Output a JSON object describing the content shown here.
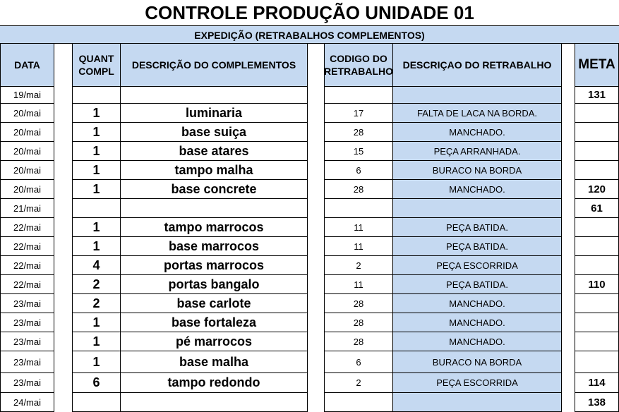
{
  "title": "CONTROLE PRODUÇÃO UNIDADE 01",
  "subtitle": "EXPEDIÇÃO (RETRABALHOS COMPLEMENTOS)",
  "headers": {
    "date": "DATA",
    "qty": "QUANT COMPL",
    "desc": "DESCRIÇÃO DO COMPLEMENTOS",
    "code": "CODIGO DO RETRABALHO",
    "retr": "DESCRIÇAO DO RETRABALHO",
    "meta": "META"
  },
  "colors": {
    "header_blue": "#c5d9f1"
  },
  "rows": [
    {
      "date": "19/mai",
      "qty": "",
      "desc": "",
      "code": "",
      "retr": "",
      "meta": "131"
    },
    {
      "date": "20/mai",
      "qty": "1",
      "desc": "luminaria",
      "code": "17",
      "retr": "FALTA DE LACA NA BORDA.",
      "meta": ""
    },
    {
      "date": "20/mai",
      "qty": "1",
      "desc": "base suiça",
      "code": "28",
      "retr": "MANCHADO.",
      "meta": ""
    },
    {
      "date": "20/mai",
      "qty": "1",
      "desc": "base atares",
      "code": "15",
      "retr": "PEÇA ARRANHADA.",
      "meta": ""
    },
    {
      "date": "20/mai",
      "qty": "1",
      "desc": "tampo malha",
      "code": "6",
      "retr": "BURACO NA BORDA",
      "meta": ""
    },
    {
      "date": "20/mai",
      "qty": "1",
      "desc": "base concrete",
      "code": "28",
      "retr": "MANCHADO.",
      "meta": "120"
    },
    {
      "date": "21/mai",
      "qty": "",
      "desc": "",
      "code": "",
      "retr": "",
      "meta": "61"
    },
    {
      "date": "22/mai",
      "qty": "1",
      "desc": "tampo marrocos",
      "code": "11",
      "retr": "PEÇA BATIDA.",
      "meta": ""
    },
    {
      "date": "22/mai",
      "qty": "1",
      "desc": "base marrocos",
      "code": "11",
      "retr": "PEÇA BATIDA.",
      "meta": ""
    },
    {
      "date": "22/mai",
      "qty": "4",
      "desc": "portas marrocos",
      "code": "2",
      "retr": "PEÇA ESCORRIDA",
      "meta": ""
    },
    {
      "date": "22/mai",
      "qty": "2",
      "desc": "portas bangalo",
      "code": "11",
      "retr": "PEÇA BATIDA.",
      "meta": "110"
    },
    {
      "date": "23/mai",
      "qty": "2",
      "desc": "base carlote",
      "code": "28",
      "retr": "MANCHADO.",
      "meta": ""
    },
    {
      "date": "23/mai",
      "qty": "1",
      "desc": "base fortaleza",
      "code": "28",
      "retr": "MANCHADO.",
      "meta": ""
    },
    {
      "date": "23/mai",
      "qty": "1",
      "desc": "pé marrocos",
      "code": "28",
      "retr": "MANCHADO.",
      "meta": ""
    },
    {
      "date": "23/mai",
      "qty": "1",
      "desc": "base malha",
      "code": "6",
      "retr": "BURACO NA BORDA",
      "meta": ""
    },
    {
      "date": "23/mai",
      "qty": "6",
      "desc": "tampo redondo",
      "code": "2",
      "retr": "PEÇA ESCORRIDA",
      "meta": "114"
    },
    {
      "date": "24/mai",
      "qty": "",
      "desc": "",
      "code": "",
      "retr": "",
      "meta": "138"
    }
  ]
}
